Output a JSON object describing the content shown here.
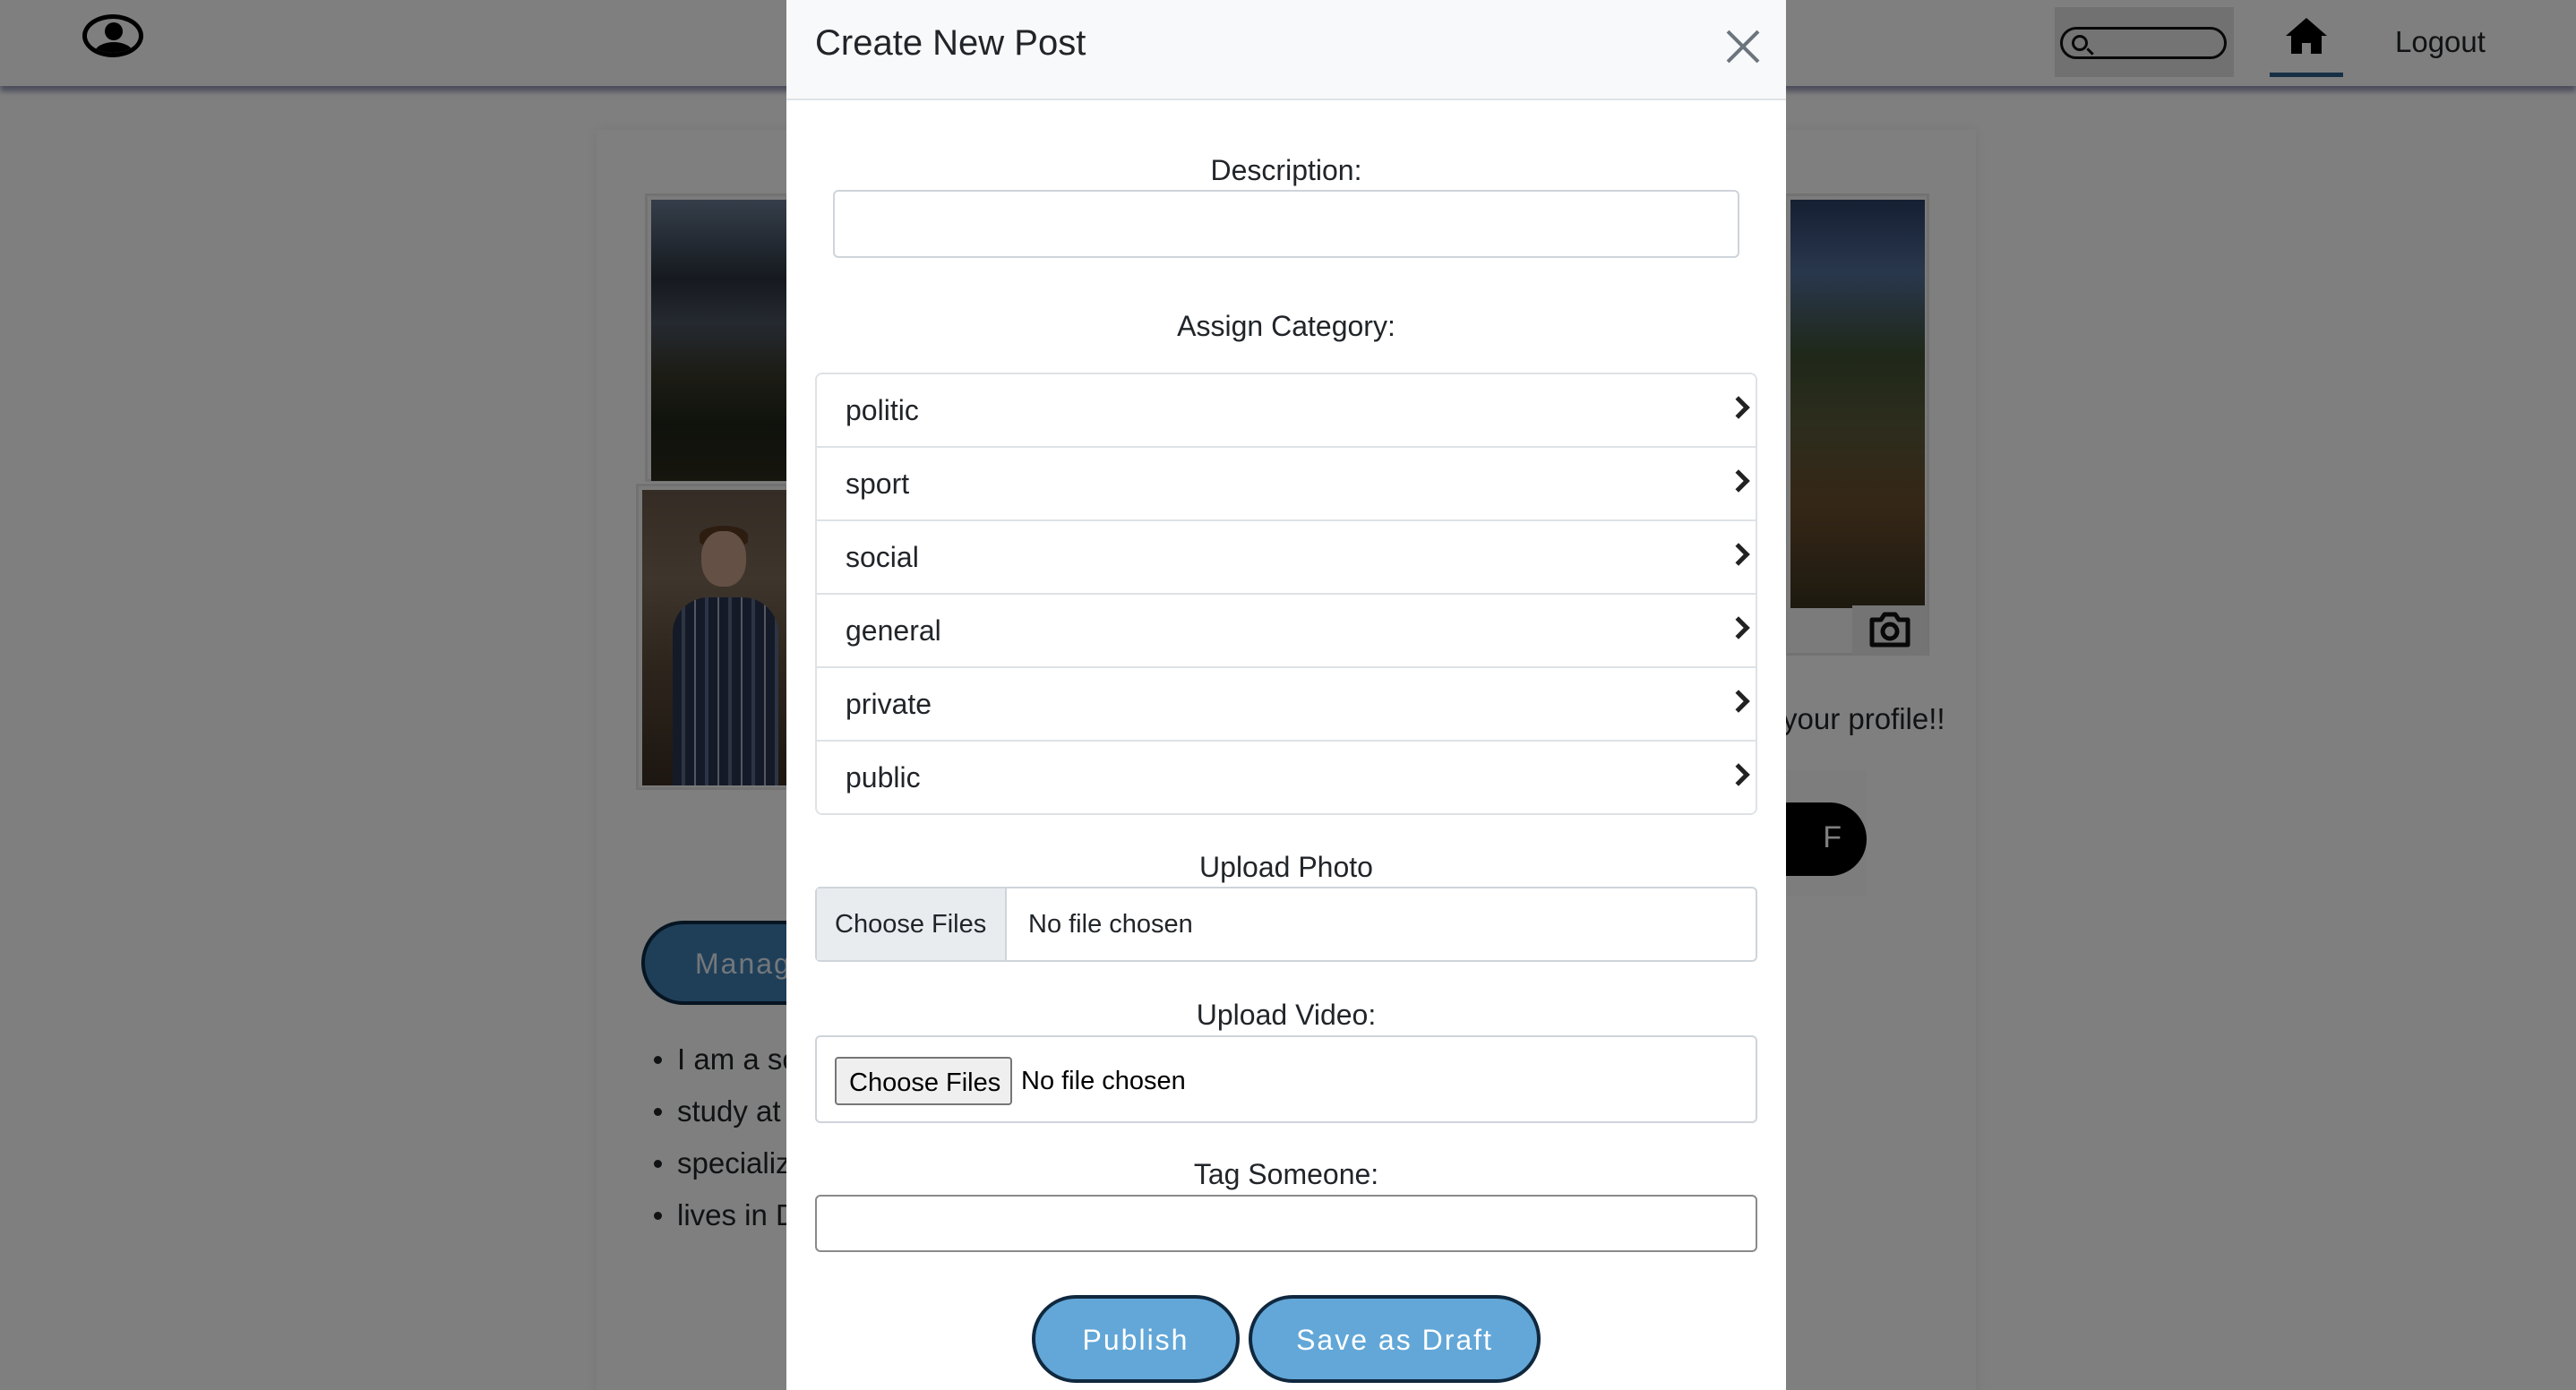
{
  "navbar": {
    "logo_icon": "user-circle-icon",
    "search_icon": "search-icon",
    "home_icon": "home-icon",
    "logout_label": "Logout"
  },
  "background": {
    "profile_prompt": "your profile!!",
    "avatar_initial": "F",
    "manage_button": "Manag",
    "bio_items": [
      "I am a sc",
      "study at",
      "specializ",
      "lives in D"
    ],
    "camera_icon": "camera-icon"
  },
  "modal": {
    "title": "Create New Post",
    "close_icon": "close-icon",
    "description_label": "Description:",
    "description_value": "",
    "category_label": "Assign Category:",
    "categories": [
      {
        "label": "politic"
      },
      {
        "label": "sport"
      },
      {
        "label": "social"
      },
      {
        "label": "general"
      },
      {
        "label": "private"
      },
      {
        "label": "public"
      }
    ],
    "upload_photo_label": "Upload Photo",
    "upload_photo_button": "Choose Files",
    "upload_photo_status": "No file chosen",
    "upload_video_label": "Upload Video:",
    "upload_video_button": "Choose Files",
    "upload_video_status": "No file chosen",
    "tag_label": "Tag Someone:",
    "tag_value": "",
    "publish_label": "Publish",
    "draft_label": "Save as Draft"
  },
  "colors": {
    "accent_button": "#62a7d8",
    "button_border": "#10283e",
    "overlay": "rgba(0,0,0,0.5)"
  }
}
